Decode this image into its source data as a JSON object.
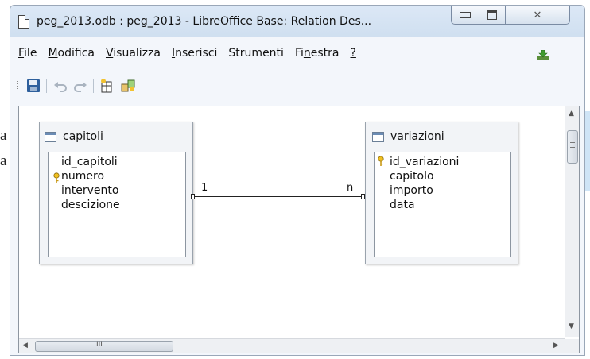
{
  "background": {
    "fragment_1": "a",
    "fragment_2": "a"
  },
  "window": {
    "title": "peg_2013.odb : peg_2013 - LibreOffice Base: Relation Des..."
  },
  "menu": {
    "items": [
      {
        "id": "file",
        "mnemonic": "F",
        "rest": "ile"
      },
      {
        "id": "modifica",
        "mnemonic": "M",
        "rest": "odifica"
      },
      {
        "id": "visualizza",
        "mnemonic": "V",
        "rest": "isualizza"
      },
      {
        "id": "inserisci",
        "mnemonic": "I",
        "rest": "nserisci"
      },
      {
        "id": "strumenti",
        "mnemonic": "",
        "rest": "Strumenti"
      },
      {
        "id": "finestra_a",
        "mnemonic": "",
        "rest": "Fi"
      },
      {
        "id": "help",
        "mnemonic": "?",
        "rest": ""
      }
    ],
    "finestra": {
      "before": "Fi",
      "mnemonic": "n",
      "after": "estra"
    }
  },
  "toolbar": {
    "icons": [
      "save-icon",
      "undo-icon",
      "redo-icon",
      "new-table-icon",
      "new-relation-icon"
    ]
  },
  "tables": {
    "capitoli": {
      "name": "capitoli",
      "fields": [
        "id_capitoli",
        "numero",
        "intervento",
        "descizione"
      ],
      "key_field": "numero"
    },
    "variazioni": {
      "name": "variazioni",
      "fields": [
        "id_variazioni",
        "capitolo",
        "importo",
        "data"
      ],
      "key_field": "id_variazioni"
    }
  },
  "relation": {
    "left_cardinality": "1",
    "right_cardinality": "n"
  },
  "scrollbar": {
    "h_thumb_grip": "III"
  },
  "colors": {
    "accent": "#6b8cb5",
    "titlebar": "#dce8f6"
  }
}
